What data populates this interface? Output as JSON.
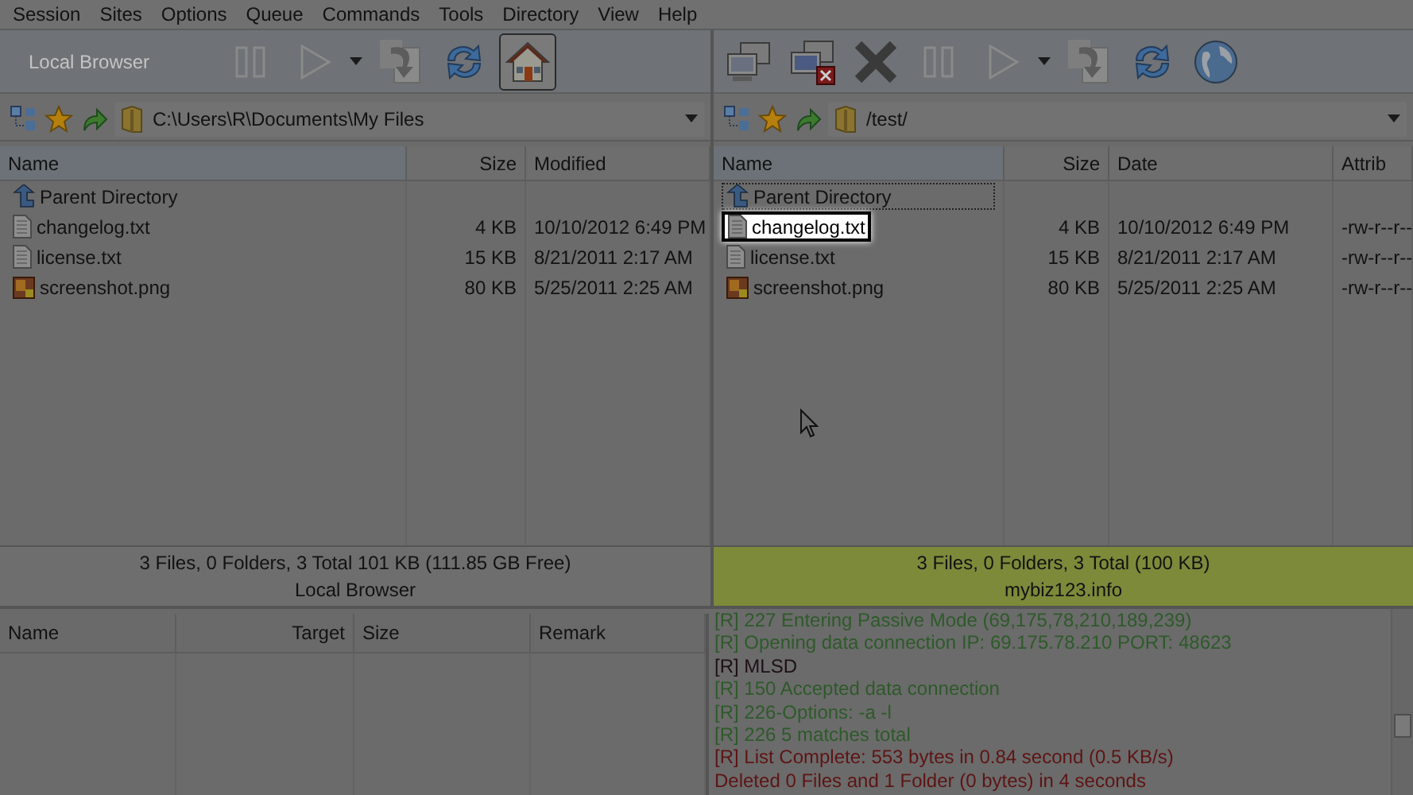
{
  "menu": [
    "Session",
    "Sites",
    "Options",
    "Queue",
    "Commands",
    "Tools",
    "Directory",
    "View",
    "Help"
  ],
  "local": {
    "toolbar_label": "Local Browser",
    "path": "C:\\Users\\R\\Documents\\My Files",
    "columns": [
      "Name",
      "Size",
      "Modified"
    ],
    "rows": [
      {
        "kind": "parent",
        "cells": [
          "Parent Directory",
          "",
          ""
        ],
        "focused": false,
        "highlighted": false
      },
      {
        "kind": "text",
        "cells": [
          "changelog.txt",
          "4 KB",
          "10/10/2012 6:49 PM"
        ],
        "focused": false,
        "highlighted": false
      },
      {
        "kind": "text",
        "cells": [
          "license.txt",
          "15 KB",
          "8/21/2011 2:17 AM"
        ],
        "focused": false,
        "highlighted": false
      },
      {
        "kind": "image",
        "cells": [
          "screenshot.png",
          "80 KB",
          "5/25/2011 2:25 AM"
        ],
        "focused": false,
        "highlighted": false
      }
    ],
    "status": "3 Files, 0 Folders, 3 Total 101 KB (111.85 GB Free)",
    "title": "Local Browser"
  },
  "remote": {
    "path": "/test/",
    "columns": [
      "Name",
      "Size",
      "Date",
      "Attrib"
    ],
    "rows": [
      {
        "kind": "parent",
        "cells": [
          "Parent Directory",
          "",
          "",
          ""
        ],
        "focused": true,
        "highlighted": false
      },
      {
        "kind": "text",
        "cells": [
          "changelog.txt",
          "4 KB",
          "10/10/2012 6:49 PM",
          "-rw-r--r--"
        ],
        "focused": false,
        "highlighted": true
      },
      {
        "kind": "text",
        "cells": [
          "license.txt",
          "15 KB",
          "8/21/2011 2:17 AM",
          "-rw-r--r--"
        ],
        "focused": false,
        "highlighted": false
      },
      {
        "kind": "image",
        "cells": [
          "screenshot.png",
          "80 KB",
          "5/25/2011 2:25 AM",
          "-rw-r--r--"
        ],
        "focused": false,
        "highlighted": false
      }
    ],
    "status": "3 Files, 0 Folders, 3 Total (100 KB)",
    "title": "mybiz123.info"
  },
  "queue": {
    "columns": [
      "Name",
      "Target",
      "Size",
      "Remark"
    ]
  },
  "log": [
    {
      "text": "[R] 227 Entering Passive Mode (69,175,78,210,189,239)",
      "color": "#2e5a2a"
    },
    {
      "text": "[R] Opening data connection IP: 69.175.78.210 PORT: 48623",
      "color": "#2e5a2a"
    },
    {
      "text": "[R] MLSD",
      "color": "#1e0f16"
    },
    {
      "text": "[R] 150 Accepted data connection",
      "color": "#2e5a2a"
    },
    {
      "text": "[R] 226-Options: -a -l",
      "color": "#2e5a2a"
    },
    {
      "text": "[R] 226 5 matches total",
      "color": "#2e5a2a"
    },
    {
      "text": "[R] List Complete: 553 bytes in 0.84 second (0.5 KB/s)",
      "color": "#5e1414"
    },
    {
      "text": "Deleted 0 Files and 1 Folder (0 bytes) in 4 seconds",
      "color": "#5e1414"
    }
  ]
}
